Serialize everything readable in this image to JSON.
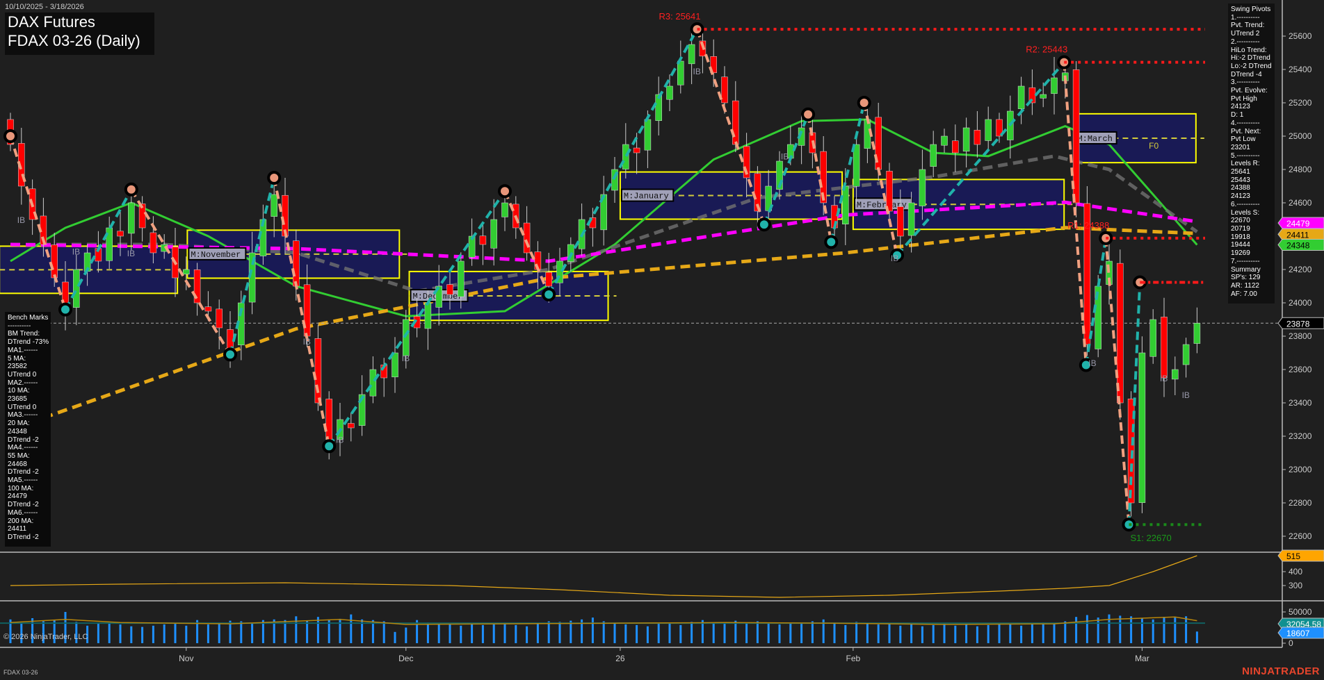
{
  "header": {
    "date_range": "10/10/2025 - 3/18/2026",
    "title_line1": "DAX Futures",
    "title_line2": "FDAX 03-26 (Daily)"
  },
  "footer": {
    "copyright": "© 2026 NinjaTrader, LLC",
    "instrument": "FDAX 03-26",
    "brand": "NINJATRADER"
  },
  "swing_pivots_panel": [
    "Swing Pivots",
    "1.----------",
    "Pvt. Trend:",
    "UTrend 2",
    "2.----------",
    "HiLo Trend:",
    "Hi:-2 DTrend",
    "Lo:-2 DTrend",
    "DTrend -4",
    "3.----------",
    "Pvt. Evolve:",
    "Pvt High",
    "24123",
    "D: 1",
    "4.----------",
    "Pvt. Next:",
    "Pvt Low",
    "23201",
    "5.----------",
    "Levels R:",
    "25641",
    "25443",
    "24388",
    "24123",
    "6.----------",
    "Levels S:",
    "22670",
    "20719",
    "19918",
    "19444",
    "19269",
    "7.----------",
    "Summary",
    "SP's: 129",
    "AR: 1122",
    "AF: 7.00"
  ],
  "bench_marks_panel": [
    "Bench Marks",
    "----------",
    "BM Trend:",
    "DTrend -73%",
    "MA1.------",
    "5 MA:",
    "23582",
    "UTrend 0",
    "MA2.------",
    "10 MA:",
    "23685",
    "UTrend 0",
    "MA3.------",
    "20 MA:",
    "24348",
    "DTrend -2",
    "MA4.------",
    "55 MA:",
    "24468",
    "DTrend -2",
    "MA5.------",
    "100 MA:",
    "24479",
    "DTrend -2",
    "MA6.------",
    "200 MA:",
    "24411",
    "DTrend -2"
  ],
  "colors": {
    "up": "#32cd32",
    "down": "#ff0000",
    "ma20": "#32cd32",
    "ma55": "#707070",
    "ma100": "#ff00ff",
    "ma200": "#e6a817",
    "zone_fill": "#191a55",
    "zone_border": "#ffff00",
    "up_leg": "#20b2aa",
    "down_leg": "#f0a080",
    "volume": "#1e90ff"
  },
  "chart_data": {
    "type": "candlestick",
    "x_months": [
      {
        "label": "Nov",
        "index": 16
      },
      {
        "label": "Dec",
        "index": 36
      },
      {
        "label": "26",
        "index": 55.5
      },
      {
        "label": "Feb",
        "index": 76.7
      },
      {
        "label": "Mar",
        "index": 103
      }
    ],
    "price_axis": {
      "ticks": [
        25600,
        25400,
        25200,
        25000,
        24800,
        24600,
        24400,
        24200,
        24000,
        23800,
        23600,
        23400,
        23200,
        23000,
        22800,
        22600
      ],
      "range": [
        22420,
        25820
      ]
    },
    "closes": [
      24950,
      24700,
      24500,
      24350,
      24150,
      23960,
      24200,
      24300,
      24250,
      24450,
      24400,
      24600,
      24450,
      24300,
      24350,
      24150,
      24200,
      24000,
      23950,
      23850,
      23720,
      24000,
      24300,
      24500,
      24650,
      24400,
      24100,
      23800,
      23400,
      23180,
      23300,
      23250,
      23450,
      23600,
      23550,
      23700,
      23900,
      23850,
      24000,
      24100,
      24050,
      24250,
      24400,
      24350,
      24500,
      24600,
      24450,
      24300,
      24200,
      24100,
      24250,
      24350,
      24500,
      24450,
      24650,
      24800,
      24950,
      24900,
      25100,
      25250,
      25300,
      25450,
      25550,
      25480,
      25380,
      25200,
      24950,
      24750,
      24550,
      24700,
      24850,
      24950,
      25050,
      24900,
      24600,
      24450,
      24700,
      24950,
      25100,
      24800,
      24550,
      24400,
      24600,
      24800,
      24950,
      25000,
      24900,
      25050,
      24950,
      25100,
      25000,
      25150,
      25300,
      25200,
      25250,
      25350,
      25380,
      24600,
      23750,
      24100,
      24250,
      23400,
      22800,
      23700,
      23900,
      23550,
      23600,
      23750,
      23878
    ],
    "swing_pivots": [
      [
        0,
        25000,
        "H"
      ],
      [
        5,
        23960,
        "L"
      ],
      [
        11,
        24680,
        "H"
      ],
      [
        20,
        23690,
        "L"
      ],
      [
        24,
        24750,
        "H"
      ],
      [
        29,
        23140,
        "L"
      ],
      [
        45,
        24670,
        "H"
      ],
      [
        49,
        24050,
        "L"
      ],
      [
        62.5,
        25641,
        "H"
      ],
      [
        68.6,
        24470,
        "L"
      ],
      [
        72.6,
        25130,
        "H"
      ],
      [
        74.7,
        24365,
        "L"
      ],
      [
        77.7,
        25200,
        "H"
      ],
      [
        80.7,
        24285,
        "L"
      ],
      [
        95.9,
        25443,
        "H"
      ],
      [
        97.9,
        23627,
        "L"
      ],
      [
        99.7,
        24388,
        "H"
      ],
      [
        101.8,
        22670,
        "L"
      ],
      [
        102.8,
        24123,
        "H"
      ]
    ],
    "moving_averages": [
      {
        "name": "20 MA",
        "value": 24348,
        "color": "#32cd32",
        "style": "solid",
        "points": [
          [
            0,
            24250
          ],
          [
            5,
            24450
          ],
          [
            11,
            24600
          ],
          [
            18,
            24400
          ],
          [
            26,
            24100
          ],
          [
            36,
            23920
          ],
          [
            45,
            23950
          ],
          [
            55,
            24350
          ],
          [
            64,
            24860
          ],
          [
            72,
            25090
          ],
          [
            78,
            25100
          ],
          [
            84,
            24900
          ],
          [
            89,
            24880
          ],
          [
            96,
            25060
          ],
          [
            100,
            24950
          ],
          [
            104,
            24650
          ],
          [
            108,
            24348
          ]
        ]
      },
      {
        "name": "55 MA",
        "value": 24468,
        "color": "#707070",
        "style": "dashed",
        "points": [
          [
            0,
            24350
          ],
          [
            14,
            24350
          ],
          [
            26,
            24300
          ],
          [
            37,
            24070
          ],
          [
            49,
            24200
          ],
          [
            68,
            24630
          ],
          [
            84,
            24755
          ],
          [
            95,
            24880
          ],
          [
            100,
            24800
          ],
          [
            108,
            24426
          ]
        ]
      },
      {
        "name": "100 MA",
        "value": 24479,
        "color": "#ff00ff",
        "style": "dashed",
        "points": [
          [
            0,
            24350
          ],
          [
            26,
            24325
          ],
          [
            49,
            24250
          ],
          [
            76,
            24527
          ],
          [
            96,
            24603
          ],
          [
            108,
            24487
          ]
        ]
      },
      {
        "name": "200 MA",
        "value": 24411,
        "color": "#e6a817",
        "style": "dashed",
        "points": [
          [
            3,
            23310
          ],
          [
            26,
            23844
          ],
          [
            49,
            24148
          ],
          [
            76,
            24300
          ],
          [
            96,
            24451
          ],
          [
            108,
            24416
          ]
        ]
      }
    ],
    "zones": [
      {
        "label": "",
        "from": -1,
        "to": 15.2,
        "low": 24057,
        "high": 24340
      },
      {
        "label": "M:November",
        "from": 16.1,
        "to": 35.4,
        "low": 24148,
        "high": 24436
      },
      {
        "label": "M:December",
        "from": 36.3,
        "to": 54.4,
        "low": 23895,
        "high": 24188
      },
      {
        "label": "M:January",
        "from": 55.5,
        "to": 75.7,
        "low": 24502,
        "high": 24785
      },
      {
        "label": "M:February",
        "from": 76.7,
        "to": 95.9,
        "low": 24441,
        "high": 24740
      },
      {
        "label": "M:March",
        "from": 96.8,
        "to": 107.9,
        "low": 24841,
        "high": 25134,
        "extra": "F0"
      }
    ],
    "levels": [
      {
        "label": "R3: 25641",
        "price": 25641,
        "from": 62.5,
        "kind": "resistance"
      },
      {
        "label": "R2: 25443",
        "price": 25443,
        "from": 95.9,
        "kind": "resistance"
      },
      {
        "label": "R1: 24388",
        "price": 24388,
        "from": 99.7,
        "kind": "resistance"
      },
      {
        "label": "",
        "price": 24123,
        "from": 102.8,
        "kind": "resistance"
      },
      {
        "label": "S1: 22670",
        "price": 22670,
        "from": 101.8,
        "kind": "support"
      }
    ],
    "ib_labels": [
      [
        1,
        24480
      ],
      [
        6,
        24290
      ],
      [
        11,
        24280
      ],
      [
        27,
        23750
      ],
      [
        30,
        23160
      ],
      [
        36,
        23650
      ],
      [
        62.5,
        25370
      ],
      [
        70.5,
        24860
      ],
      [
        80.5,
        24250
      ],
      [
        98.5,
        23620
      ],
      [
        105,
        23530
      ],
      [
        107,
        23430
      ]
    ],
    "last_price": 23878,
    "price_tags": [
      {
        "value": "24479",
        "bg": "#ff00ff",
        "fg": "#ffffff",
        "price": 24479
      },
      {
        "value": "24411",
        "bg": "#e6a817",
        "fg": "#000000",
        "price": 24411
      },
      {
        "value": "24348",
        "bg": "#32cd32",
        "fg": "#000000",
        "price": 24348
      },
      {
        "value": "23878",
        "bg": "#000000",
        "fg": "#ffffff",
        "price": 23878
      }
    ],
    "oscillator": {
      "ticks": [
        400,
        300
      ],
      "last": "515",
      "points": [
        [
          0,
          300
        ],
        [
          10,
          310
        ],
        [
          25,
          320
        ],
        [
          40,
          300
        ],
        [
          50,
          270
        ],
        [
          60,
          230
        ],
        [
          70,
          215
        ],
        [
          80,
          230
        ],
        [
          90,
          260
        ],
        [
          96,
          280
        ],
        [
          100,
          300
        ],
        [
          104,
          400
        ],
        [
          108,
          515
        ]
      ]
    },
    "volume": {
      "ticks": [
        50000,
        0
      ],
      "avg_label": "32054.58",
      "avg": 32054.58,
      "last_label": "18607",
      "values": [
        38000,
        33000,
        40000,
        35000,
        37000,
        50000,
        34000,
        28000,
        31000,
        33000,
        30000,
        27000,
        26000,
        28000,
        30000,
        31000,
        28000,
        37000,
        30000,
        33000,
        36000,
        35000,
        31000,
        37000,
        38000,
        37000,
        43000,
        36000,
        42000,
        38000,
        39000,
        46000,
        38000,
        37000,
        35000,
        18000,
        25000,
        37000,
        33000,
        31000,
        32000,
        28000,
        31000,
        29000,
        30000,
        33000,
        29000,
        27000,
        31000,
        35000,
        34000,
        36000,
        38000,
        41000,
        35000,
        33000,
        30000,
        29000,
        27000,
        31000,
        33000,
        29000,
        34000,
        37000,
        32000,
        31000,
        36000,
        33000,
        35000,
        32000,
        30000,
        33000,
        31000,
        35000,
        38000,
        33000,
        29000,
        34000,
        31000,
        30000,
        32000,
        28000,
        30000,
        27000,
        29000,
        31000,
        28000,
        30000,
        27000,
        29000,
        31000,
        30000,
        28000,
        30000,
        33000,
        31000,
        35000,
        42000,
        45000,
        41000,
        46000,
        44000,
        43000,
        40000,
        38000,
        42000,
        41000,
        43000,
        18607
      ],
      "ma_points": [
        [
          0,
          33000
        ],
        [
          5,
          38000
        ],
        [
          10,
          33000
        ],
        [
          20,
          31000
        ],
        [
          30,
          38000
        ],
        [
          36,
          30000
        ],
        [
          45,
          31000
        ],
        [
          55,
          32000
        ],
        [
          65,
          33000
        ],
        [
          75,
          32000
        ],
        [
          85,
          30000
        ],
        [
          95,
          31000
        ],
        [
          100,
          38000
        ],
        [
          106,
          42000
        ],
        [
          108,
          36000
        ]
      ]
    }
  }
}
